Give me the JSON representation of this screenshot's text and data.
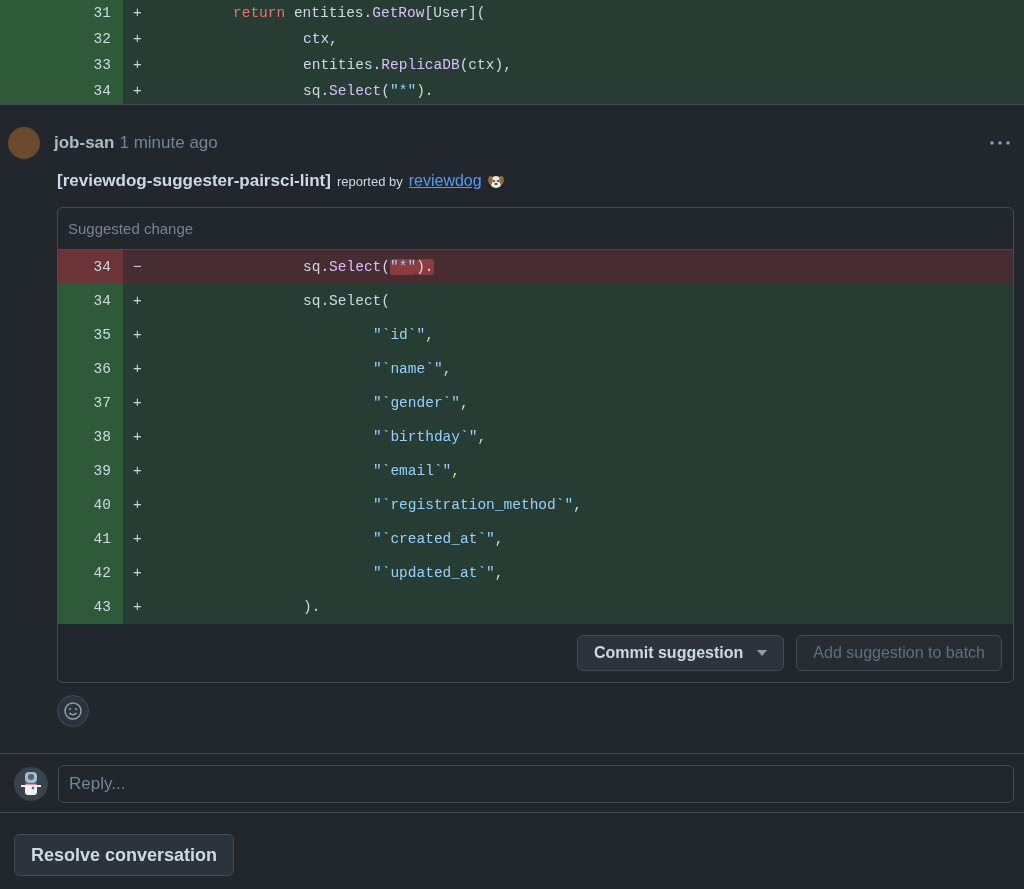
{
  "top_diff": {
    "lines": [
      {
        "number": "31",
        "sign": "+",
        "kind": "added",
        "tokens": [
          {
            "kind": "tab"
          },
          {
            "text": "return",
            "kind": "keyword"
          },
          {
            "text": " entities.",
            "kind": "plain"
          },
          {
            "text": "GetRow",
            "kind": "func"
          },
          {
            "text": "[User](",
            "kind": "plain"
          }
        ]
      },
      {
        "number": "32",
        "sign": "+",
        "kind": "added",
        "tokens": [
          {
            "kind": "tab"
          },
          {
            "kind": "tab"
          },
          {
            "text": "ctx,",
            "kind": "plain"
          }
        ]
      },
      {
        "number": "33",
        "sign": "+",
        "kind": "added",
        "tokens": [
          {
            "kind": "tab"
          },
          {
            "kind": "tab"
          },
          {
            "text": "entities.",
            "kind": "plain"
          },
          {
            "text": "ReplicaDB",
            "kind": "func"
          },
          {
            "text": "(ctx),",
            "kind": "plain"
          }
        ]
      },
      {
        "number": "34",
        "sign": "+",
        "kind": "added",
        "tokens": [
          {
            "kind": "tab"
          },
          {
            "kind": "tab"
          },
          {
            "text": "sq.",
            "kind": "plain"
          },
          {
            "text": "Select",
            "kind": "func"
          },
          {
            "text": "(",
            "kind": "plain"
          },
          {
            "text": "\"*\"",
            "kind": "string"
          },
          {
            "text": ").",
            "kind": "plain"
          }
        ]
      }
    ]
  },
  "comment": {
    "author": "job-san",
    "time": "1 minute ago",
    "linter": "[reviewdog-suggester-pairsci-lint]",
    "reported_by": "reported by",
    "link": "reviewdog"
  },
  "suggestion": {
    "title": "Suggested change",
    "lines": [
      {
        "number": "34",
        "sign": "−",
        "kind": "removed",
        "tokens": [
          {
            "kind": "tab"
          },
          {
            "kind": "tab"
          },
          {
            "text": "sq.",
            "kind": "plain"
          },
          {
            "text": "Select",
            "kind": "func"
          },
          {
            "text": "(",
            "kind": "plain"
          },
          {
            "text": "\"*\"",
            "kind": "string",
            "highlight": true
          },
          {
            "text": ").",
            "kind": "plain",
            "highlight": true
          }
        ]
      },
      {
        "number": "34",
        "sign": "+",
        "kind": "added",
        "tokens": [
          {
            "kind": "tab"
          },
          {
            "kind": "tab"
          },
          {
            "text": "sq.Select(",
            "kind": "plain"
          }
        ]
      },
      {
        "number": "35",
        "sign": "+",
        "kind": "added",
        "tokens": [
          {
            "kind": "tab"
          },
          {
            "kind": "tab"
          },
          {
            "kind": "tab"
          },
          {
            "text": "\"`id`\"",
            "kind": "string"
          },
          {
            "text": ",",
            "kind": "plain"
          }
        ]
      },
      {
        "number": "36",
        "sign": "+",
        "kind": "added",
        "tokens": [
          {
            "kind": "tab"
          },
          {
            "kind": "tab"
          },
          {
            "kind": "tab"
          },
          {
            "text": "\"`name`\"",
            "kind": "string"
          },
          {
            "text": ",",
            "kind": "plain"
          }
        ]
      },
      {
        "number": "37",
        "sign": "+",
        "kind": "added",
        "tokens": [
          {
            "kind": "tab"
          },
          {
            "kind": "tab"
          },
          {
            "kind": "tab"
          },
          {
            "text": "\"`gender`\"",
            "kind": "string"
          },
          {
            "text": ",",
            "kind": "plain"
          }
        ]
      },
      {
        "number": "38",
        "sign": "+",
        "kind": "added",
        "tokens": [
          {
            "kind": "tab"
          },
          {
            "kind": "tab"
          },
          {
            "kind": "tab"
          },
          {
            "text": "\"`birthday`\"",
            "kind": "string"
          },
          {
            "text": ",",
            "kind": "plain"
          }
        ]
      },
      {
        "number": "39",
        "sign": "+",
        "kind": "added",
        "tokens": [
          {
            "kind": "tab"
          },
          {
            "kind": "tab"
          },
          {
            "kind": "tab"
          },
          {
            "text": "\"`email`\"",
            "kind": "string"
          },
          {
            "text": ",",
            "kind": "plain"
          }
        ]
      },
      {
        "number": "40",
        "sign": "+",
        "kind": "added",
        "tokens": [
          {
            "kind": "tab"
          },
          {
            "kind": "tab"
          },
          {
            "kind": "tab"
          },
          {
            "text": "\"`registration_method`\"",
            "kind": "string"
          },
          {
            "text": ",",
            "kind": "plain"
          }
        ]
      },
      {
        "number": "41",
        "sign": "+",
        "kind": "added",
        "tokens": [
          {
            "kind": "tab"
          },
          {
            "kind": "tab"
          },
          {
            "kind": "tab"
          },
          {
            "text": "\"`created_at`\"",
            "kind": "string"
          },
          {
            "text": ",",
            "kind": "plain"
          }
        ]
      },
      {
        "number": "42",
        "sign": "+",
        "kind": "added",
        "tokens": [
          {
            "kind": "tab"
          },
          {
            "kind": "tab"
          },
          {
            "kind": "tab"
          },
          {
            "text": "\"`updated_at`\"",
            "kind": "string"
          },
          {
            "text": ",",
            "kind": "plain"
          }
        ]
      },
      {
        "number": "43",
        "sign": "+",
        "kind": "added",
        "tokens": [
          {
            "kind": "tab"
          },
          {
            "kind": "tab"
          },
          {
            "text": ").",
            "kind": "plain"
          }
        ]
      }
    ],
    "buttons": [
      {
        "label": "Commit suggestion",
        "disabled": false,
        "dropdown": true
      },
      {
        "label": "Add suggestion to batch",
        "disabled": true,
        "dropdown": false
      }
    ]
  },
  "reply": {
    "placeholder": "Reply..."
  },
  "resolve_button": "Resolve conversation"
}
